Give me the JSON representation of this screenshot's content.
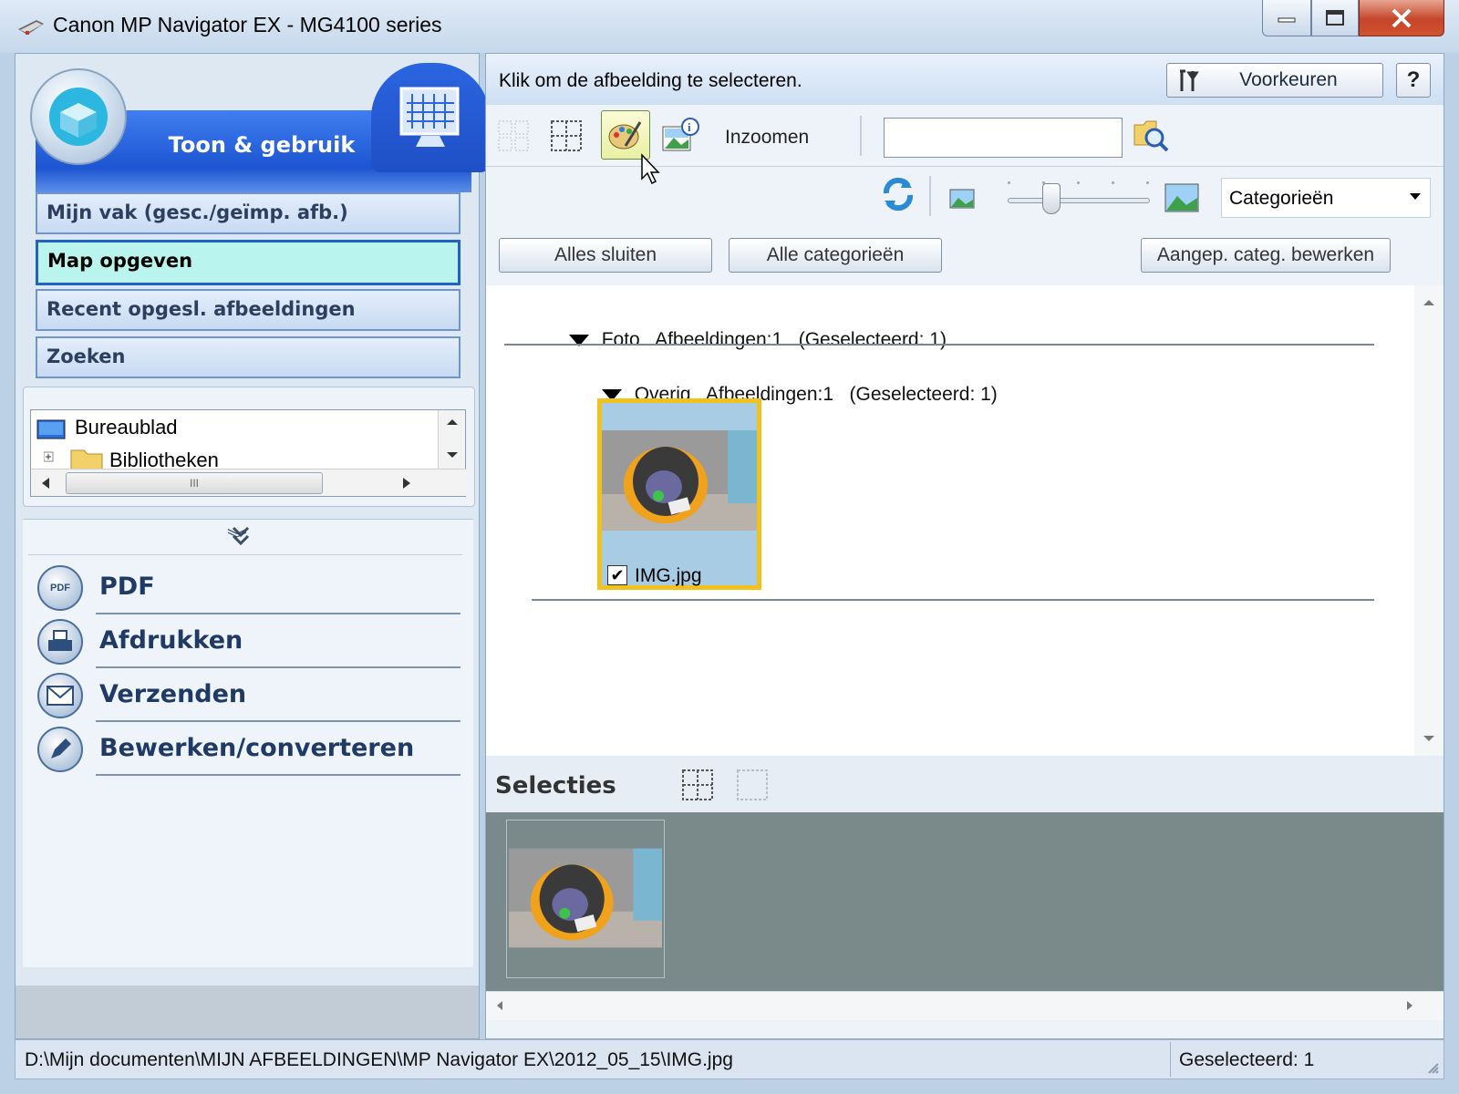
{
  "window": {
    "title": "Canon MP Navigator EX - MG4100 series"
  },
  "hero": {
    "title": "Toon & gebruik"
  },
  "nav": {
    "items": [
      {
        "label": "Mijn vak (gesc./geïmp. afb.)"
      },
      {
        "label": "Map opgeven"
      },
      {
        "label": "Recent opgesl. afbeeldingen"
      },
      {
        "label": "Zoeken"
      }
    ]
  },
  "tree": {
    "items": [
      {
        "label": "Bureaublad"
      },
      {
        "label": "Bibliotheken"
      }
    ],
    "hscroll_grip": "III"
  },
  "actions": [
    {
      "label": "PDF",
      "icon": "PDF"
    },
    {
      "label": "Afdrukken"
    },
    {
      "label": "Verzenden"
    },
    {
      "label": "Bewerken/converteren"
    }
  ],
  "infobar": {
    "text": "Klik om de afbeelding te selecteren.",
    "preferences_label": "Voorkeuren",
    "help_label": "?"
  },
  "toolbar": {
    "zoom_label": "Inzoomen",
    "search_value": ""
  },
  "view": {
    "sort_select": "Categorieën"
  },
  "buttons": {
    "close_all": "Alles sluiten",
    "all_categories": "Alle categorieën",
    "edit_custom": "Aangep. categ. bewerken"
  },
  "categories": {
    "foto": {
      "name": "Foto",
      "count": "Afbeeldingen:1",
      "selected": "(Geselecteerd: 1)"
    },
    "overig": {
      "name": "Overig",
      "count": "Afbeeldingen:1",
      "selected": "(Geselecteerd: 1)"
    }
  },
  "thumbnail": {
    "filename": "IMG.jpg",
    "checked": true
  },
  "selections": {
    "title": "Selecties"
  },
  "status": {
    "path": "D:\\Mijn documenten\\MIJN AFBEELDINGEN\\MP Navigator EX\\2012_05_15\\IMG.jpg",
    "selected": "Geselecteerd: 1"
  },
  "colors": {
    "accent_blue": "#1d55d2",
    "selected_border": "#f1c21c",
    "active_nav": "#b9f4ee"
  }
}
